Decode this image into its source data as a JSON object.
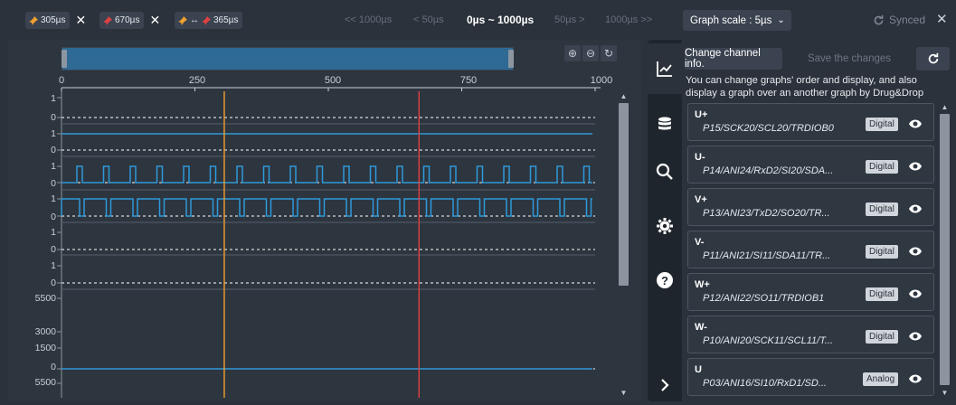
{
  "markers": [
    {
      "label": "305µs",
      "color": "#f0a030"
    },
    {
      "label": "670µs",
      "color": "#e04040"
    },
    {
      "label": "365µs",
      "arrow": "↔",
      "colors": [
        "#f0a030",
        "#e04040"
      ]
    }
  ],
  "nav": {
    "prev_far": "<< 1000µs",
    "prev_near": "< 50µs",
    "range": "0µs ~ 1000µs",
    "next_near": "50µs >",
    "next_far": "1000µs >>"
  },
  "graph_scale": {
    "label": "Graph scale : 5µs"
  },
  "sync": {
    "label": "Synced"
  },
  "x_axis": {
    "ticks": [
      "0",
      "250",
      "500",
      "750",
      "1000"
    ]
  },
  "y_labels": [
    {
      "text": "1"
    },
    {
      "text": "0"
    },
    {
      "text": "1"
    },
    {
      "text": "0"
    },
    {
      "text": "1"
    },
    {
      "text": "0"
    },
    {
      "text": "1"
    },
    {
      "text": "0"
    },
    {
      "text": "1"
    },
    {
      "text": "0"
    },
    {
      "text": "1"
    },
    {
      "text": "0"
    },
    {
      "text": "5500"
    },
    {
      "text": "3000"
    },
    {
      "text": "1500"
    },
    {
      "text": "0"
    },
    {
      "text": "5500"
    }
  ],
  "cursors": [
    {
      "time": 305,
      "color": "#f0a030"
    },
    {
      "time": 670,
      "color": "#e04040"
    }
  ],
  "colors": {
    "trace": "#2e9ad9",
    "accent": "#2f6a94"
  },
  "sidebar": {
    "tabs": [
      {
        "icon": "line-chart-icon",
        "active": true
      },
      {
        "icon": "database-icon"
      },
      {
        "icon": "search-icon"
      },
      {
        "icon": "gear-icon"
      },
      {
        "icon": "help-icon"
      },
      {
        "icon": "chevron-right-icon"
      }
    ]
  },
  "panel": {
    "change_btn": "Change channel info.",
    "save_btn": "Save the changes",
    "hint": "You can change graphs' order and display, and also display a graph over an another graph by Drug&Drop"
  },
  "channels": [
    {
      "name": "U+",
      "pins": "P15/SCK20/SCL20/TRDIOB0",
      "type": "Digital"
    },
    {
      "name": "U-",
      "pins": "P14/ANI24/RxD2/SI20/SDA...",
      "type": "Digital"
    },
    {
      "name": "V+",
      "pins": "P13/ANI23/TxD2/SO20/TR...",
      "type": "Digital"
    },
    {
      "name": "V-",
      "pins": "P11/ANI21/SI11/SDA11/TR...",
      "type": "Digital"
    },
    {
      "name": "W+",
      "pins": "P12/ANI22/SO11/TRDIOB1",
      "type": "Digital"
    },
    {
      "name": "W-",
      "pins": "P10/ANI20/SCK11/SCL11/T...",
      "type": "Digital"
    },
    {
      "name": "U",
      "pins": "P03/ANI16/SI10/RxD1/SD...",
      "type": "Analog"
    }
  ]
}
